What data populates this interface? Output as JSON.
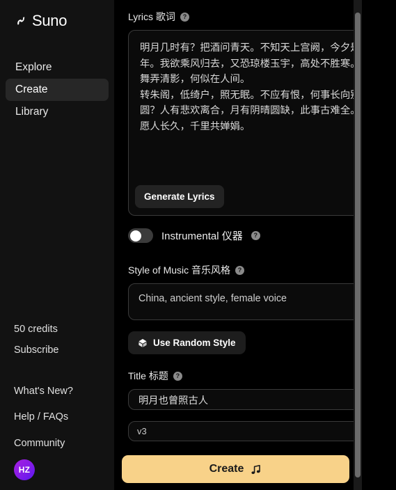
{
  "sidebar": {
    "brand": "Suno",
    "nav": [
      {
        "label": "Explore",
        "active": false
      },
      {
        "label": "Create",
        "active": true
      },
      {
        "label": "Library",
        "active": false
      }
    ],
    "credits": "50 credits",
    "subscribe": "Subscribe",
    "links": [
      "What's New?",
      "Help / FAQs",
      "Community"
    ],
    "avatar_initials": "HZ"
  },
  "main": {
    "lyrics": {
      "label": "Lyrics 歌词",
      "value": "明月几时有？把酒问青天。不知天上宫阙，今夕是何年。我欲乘风归去，又恐琼楼玉宇，高处不胜寒。起舞弄清影，何似在人间。\n转朱阁，低绮户，照无眠。不应有恨，何事长向别时圆？人有悲欢离合，月有阴晴圆缺，此事古难全。但愿人长久，千里共婵娟。",
      "generate_button": "Generate Lyrics"
    },
    "instrumental": {
      "label": "Instrumental 仪器",
      "enabled": false
    },
    "style": {
      "label": "Style of Music 音乐风格",
      "value": "China, ancient style, female voice",
      "random_button": "Use Random Style"
    },
    "title": {
      "label": "Title 标题",
      "value": "明月也曾照古人"
    },
    "version": {
      "selected": "v3"
    },
    "create_button": "Create"
  },
  "colors": {
    "accent": "#f8d289",
    "sidebar_bg": "#121212",
    "panel_bg": "#000000",
    "field_border": "#3a3a3a"
  }
}
